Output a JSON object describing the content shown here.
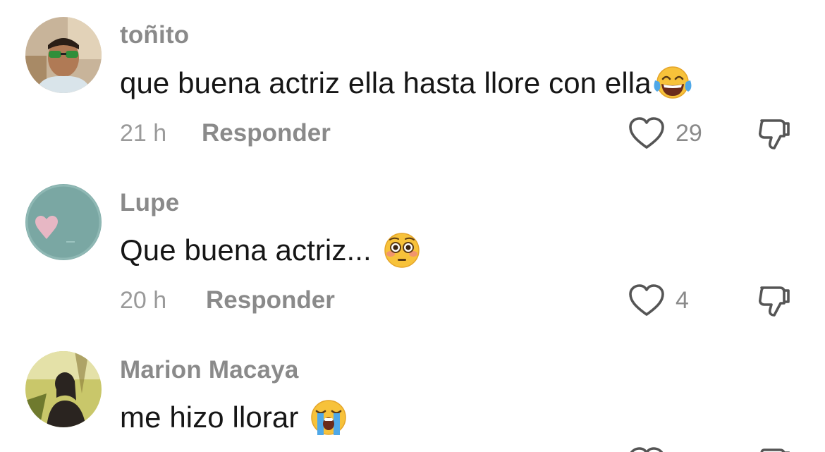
{
  "comments": [
    {
      "username": "toñito",
      "text": "que buena actriz ella hasta llore con ella",
      "emoji": "tears-of-joy",
      "time": "21 h",
      "reply_label": "Responder",
      "likes": "29",
      "avatar_colors": {
        "bg": "#c8b49a",
        "skin": "#b07a55",
        "shirt": "#d9e4ea"
      }
    },
    {
      "username": "Lupe",
      "text": "Que buena actriz... ",
      "emoji": "flushed",
      "time": "20 h",
      "reply_label": "Responder",
      "likes": "4",
      "avatar_colors": {
        "bg": "#7aa7a3",
        "heart": "#e7b7c4"
      }
    },
    {
      "username": "Marion Macaya",
      "text": "me hizo llorar ",
      "emoji": "loudly-crying",
      "avatar_colors": {
        "bg": "#c9c76a",
        "dark": "#2a2420"
      }
    }
  ],
  "colors": {
    "text": "#161616",
    "secondary": "#8a8a8a",
    "icon": "#555555"
  }
}
